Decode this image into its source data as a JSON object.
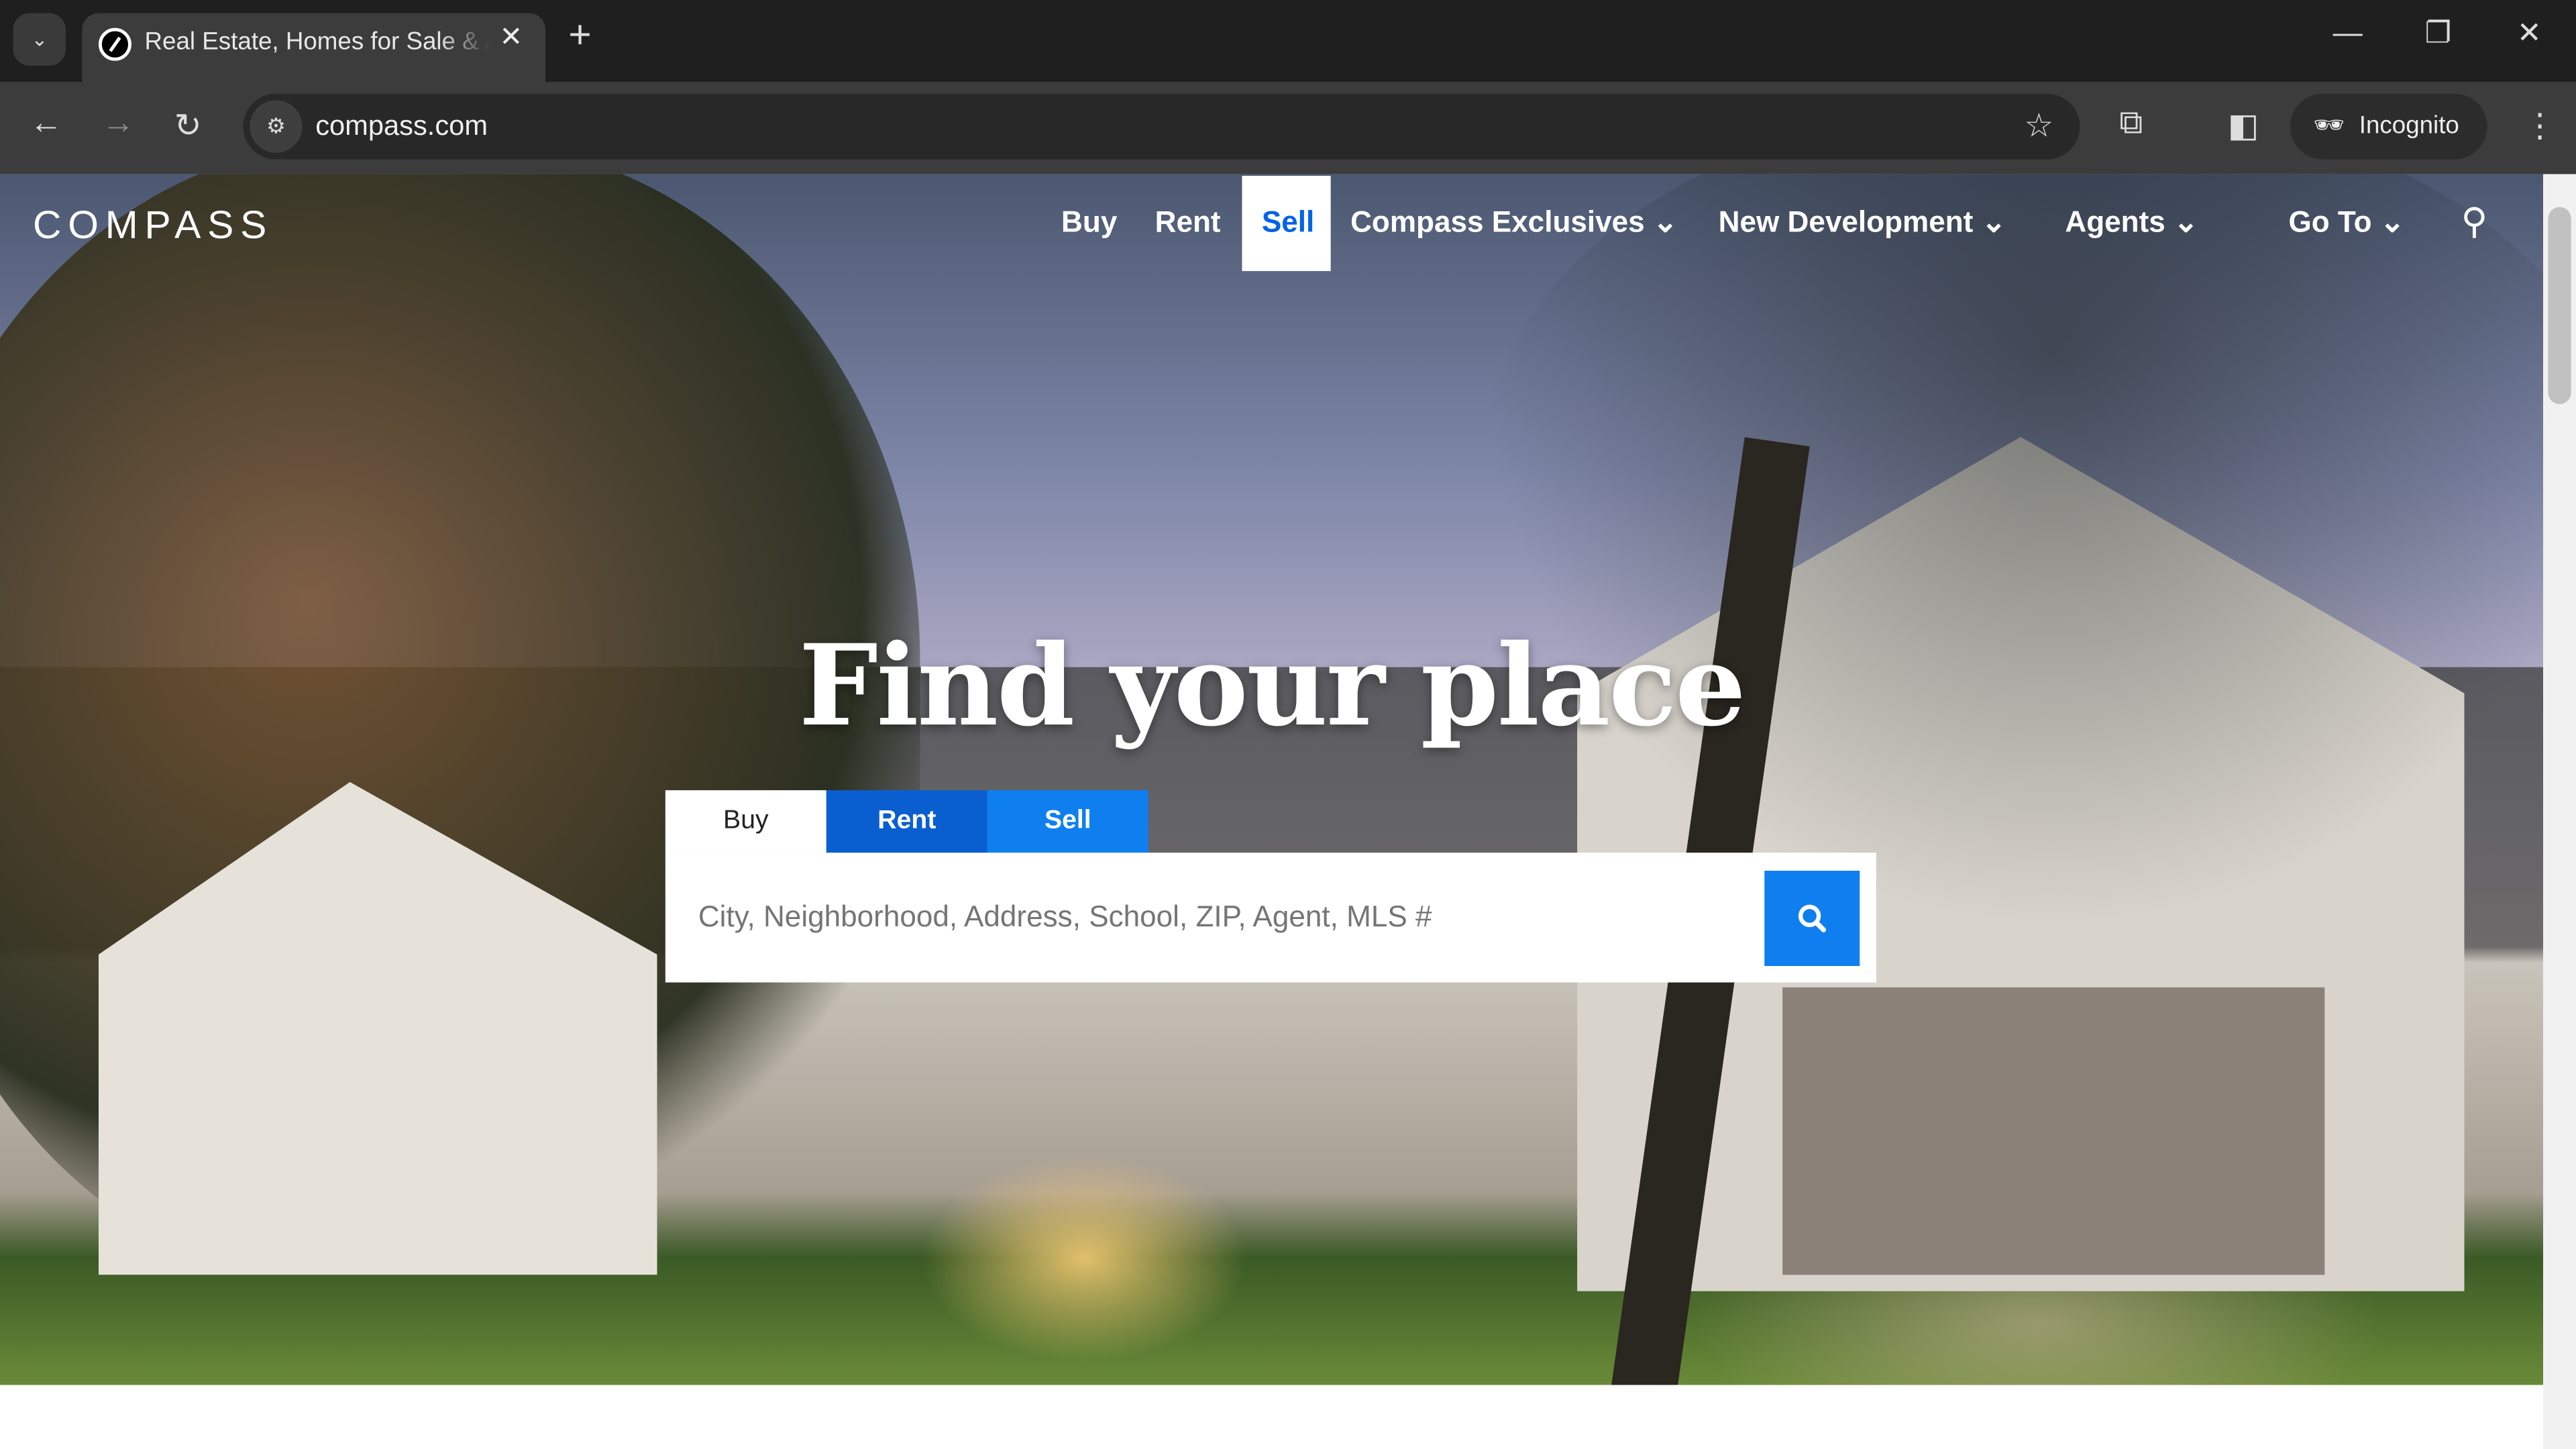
{
  "browser": {
    "tab_title": "Real Estate, Homes for Sale & Apartments",
    "url": "compass.com",
    "incognito_label": "Incognito"
  },
  "site": {
    "logo": "COMPASS",
    "nav": [
      {
        "label": "Buy"
      },
      {
        "label": "Rent"
      },
      {
        "label": "Sell"
      },
      {
        "label": "Compass Exclusives"
      },
      {
        "label": "New Development"
      },
      {
        "label": "Agents"
      },
      {
        "label": "Go To"
      }
    ],
    "active_nav": "Sell"
  },
  "hero": {
    "headline": "Find your place",
    "search_tabs": [
      {
        "label": "Buy"
      },
      {
        "label": "Rent"
      },
      {
        "label": "Sell"
      }
    ],
    "selected_tab": "Buy",
    "search_placeholder": "City, Neighborhood, Address, School, ZIP, Agent, MLS #",
    "search_value": ""
  },
  "colors": {
    "accent": "#0064e5",
    "rent_tab": "#0a5fd0",
    "sell_tab": "#0f7ff0"
  }
}
